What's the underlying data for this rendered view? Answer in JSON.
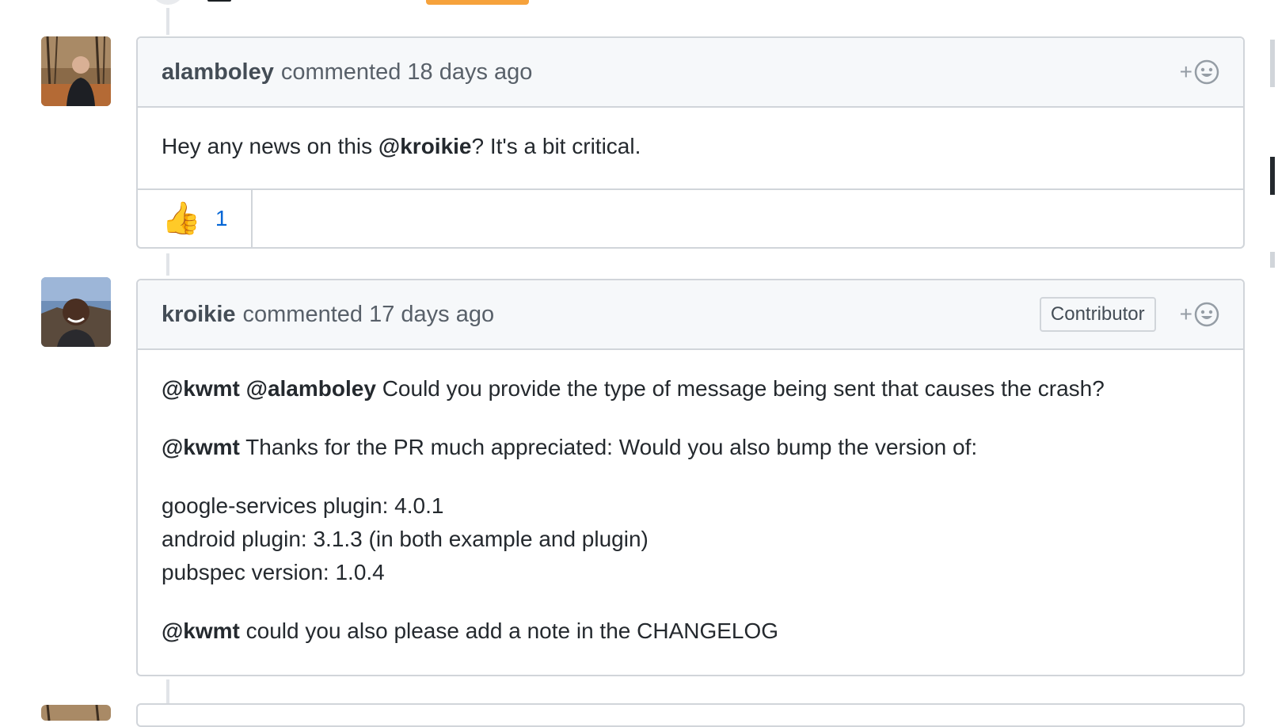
{
  "comments": [
    {
      "author": "alamboley",
      "action": "commented",
      "time": "18 days ago",
      "body": {
        "text_before": "Hey any news on this ",
        "mention": "@kroikie",
        "text_after": "? It's a bit critical."
      },
      "reactions": [
        {
          "emoji": "👍",
          "count": "1"
        }
      ]
    },
    {
      "author": "kroikie",
      "action": "commented",
      "time": "17 days ago",
      "badge": "Contributor",
      "body": {
        "p1_m1": "@kwmt",
        "p1_m2": "@alamboley",
        "p1_text": " Could you provide the type of message being sent that causes the crash?",
        "p2_m": "@kwmt",
        "p2_text": " Thanks for the PR much appreciated: Would you also bump the version of:",
        "list": [
          "google-services plugin: 4.0.1",
          "android plugin: 3.1.3 (in both example and plugin)",
          "pubspec version: 1.0.4"
        ],
        "p4_m": "@kwmt",
        "p4_text": " could you also please add a note in the CHANGELOG"
      }
    }
  ],
  "react_button": {
    "plus": "+"
  },
  "colors": {
    "link": "#0366d6",
    "border": "#d1d5da",
    "header_bg": "#f6f8fa"
  }
}
